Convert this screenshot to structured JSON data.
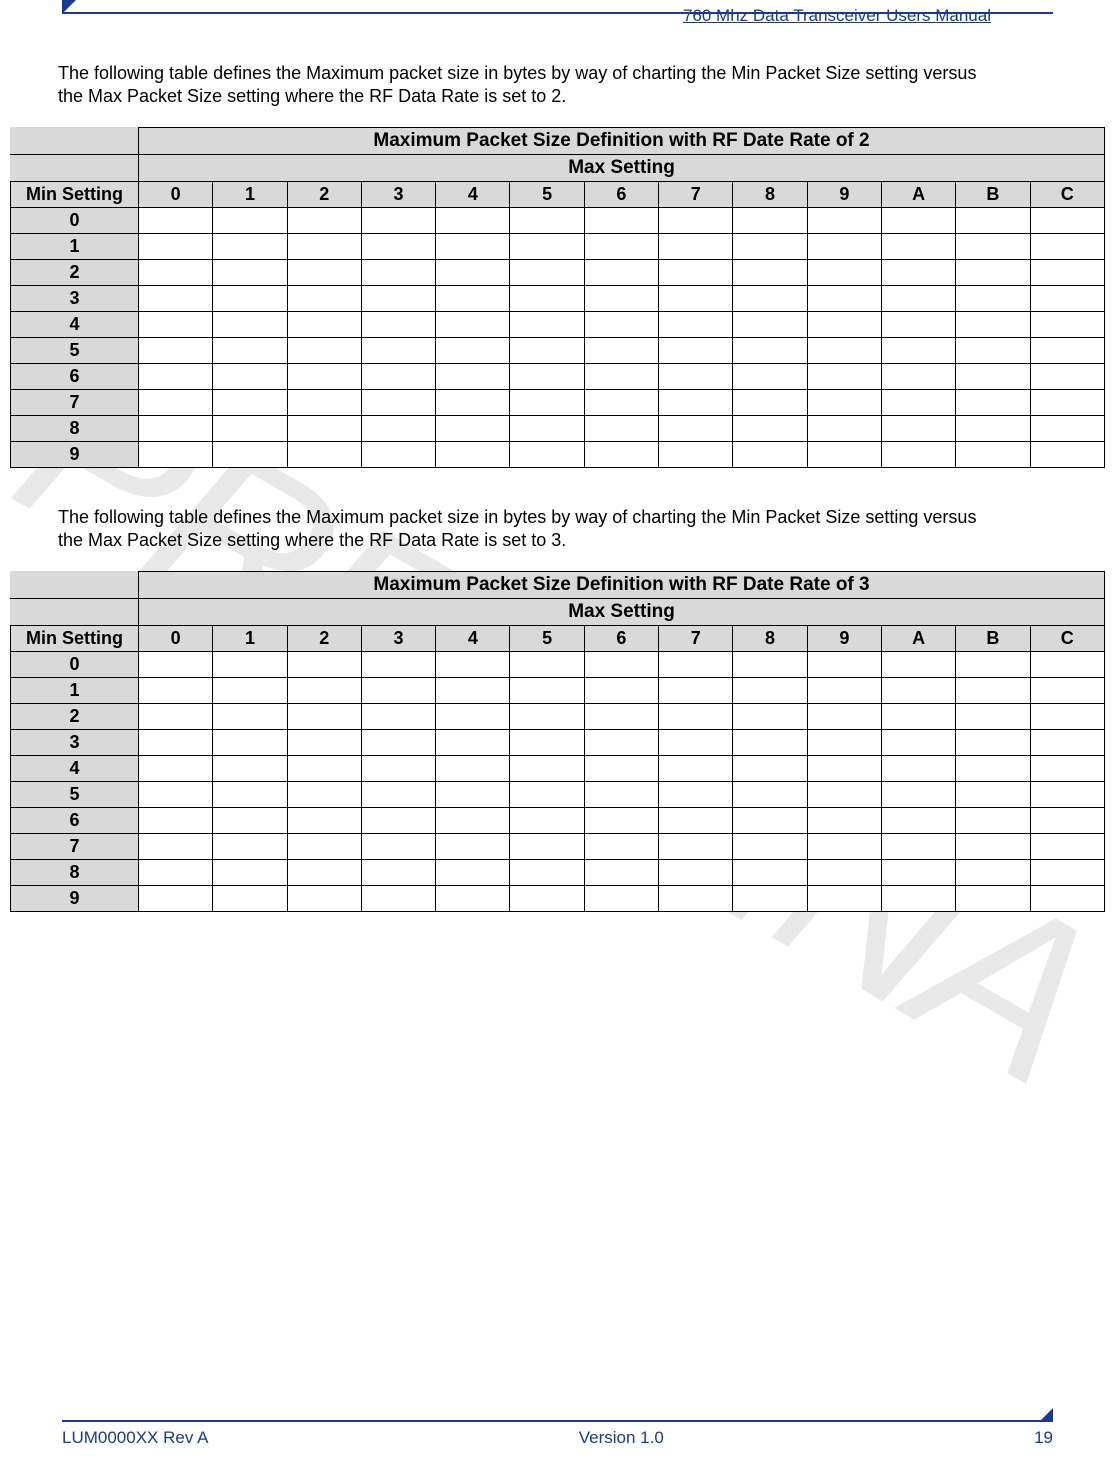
{
  "header": {
    "title": "760 Mhz Data Transceiver Users Manual"
  },
  "watermark": "PRELIMINA",
  "sections": [
    {
      "intro": "The following table defines the Maximum packet size in bytes by way of charting the Min Packet Size setting versus the Max Packet Size setting where the RF Data Rate is set to 2.",
      "table_title": "Maximum Packet Size Definition with RF Date Rate of 2",
      "max_setting_label": "Max Setting",
      "min_setting_label": "Min Setting",
      "columns": [
        "0",
        "1",
        "2",
        "3",
        "4",
        "5",
        "6",
        "7",
        "8",
        "9",
        "A",
        "B",
        "C"
      ],
      "rows": [
        "0",
        "1",
        "2",
        "3",
        "4",
        "5",
        "6",
        "7",
        "8",
        "9"
      ]
    },
    {
      "intro": "The following table defines the Maximum packet size in bytes by way of charting the Min Packet Size setting versus the Max Packet Size setting where the RF Data Rate is set to 3.",
      "table_title": "Maximum Packet Size Definition with RF Date Rate of 3",
      "max_setting_label": "Max Setting",
      "min_setting_label": "Min Setting",
      "columns": [
        "0",
        "1",
        "2",
        "3",
        "4",
        "5",
        "6",
        "7",
        "8",
        "9",
        "A",
        "B",
        "C"
      ],
      "rows": [
        "0",
        "1",
        "2",
        "3",
        "4",
        "5",
        "6",
        "7",
        "8",
        "9"
      ]
    }
  ],
  "footer": {
    "left": "LUM0000XX Rev A",
    "center": "Version 1.0",
    "right": "19"
  }
}
